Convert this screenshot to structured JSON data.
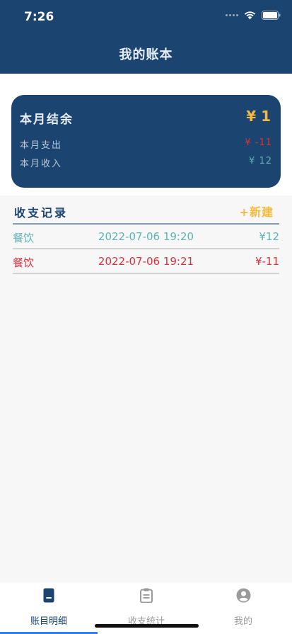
{
  "status_bar": {
    "time": "7:26"
  },
  "nav": {
    "title": "我的账本"
  },
  "summary": {
    "label": "本月结余",
    "balance": "¥ 1",
    "expense_label": "本月支出",
    "expense_value": "¥ -11",
    "income_label": "本月收入",
    "income_value": "¥ 12"
  },
  "records": {
    "title": "收支记录",
    "new_label": "+新建",
    "items": [
      {
        "category": "餐饮",
        "time": "2022-07-06 19:20",
        "amount": "¥12",
        "kind": "income"
      },
      {
        "category": "餐饮",
        "time": "2022-07-06 19:21",
        "amount": "¥-11",
        "kind": "expense"
      }
    ]
  },
  "tabs": [
    {
      "label": "账目明细",
      "icon": "document-icon",
      "active": true
    },
    {
      "label": "收支统计",
      "icon": "clipboard-icon",
      "active": false
    },
    {
      "label": "我的",
      "icon": "user-icon",
      "active": false
    }
  ],
  "colors": {
    "primary": "#1b4470",
    "accent": "#f6b93b",
    "income": "#5fb3b3",
    "expense": "#d6333f",
    "tab_indicator": "#2f80ed"
  }
}
